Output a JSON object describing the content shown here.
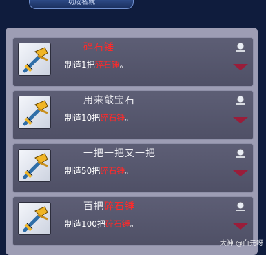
{
  "header": {
    "tab_title": "功成名就"
  },
  "cards": [
    {
      "title_plain": "",
      "title_highlight": "碎石锤",
      "desc_prefix": "制造1把",
      "desc_highlight": "碎石锤",
      "desc_suffix": "。"
    },
    {
      "title_plain": "用来敲宝石",
      "title_highlight": "",
      "desc_prefix": "制造10把",
      "desc_highlight": "碎石锤",
      "desc_suffix": "。"
    },
    {
      "title_plain": "一把一把又一把",
      "title_highlight": "",
      "desc_prefix": "制造50把",
      "desc_highlight": "碎石锤",
      "desc_suffix": "。"
    },
    {
      "title_plain": "百把",
      "title_highlight": "碎石锤",
      "desc_prefix": "制造100把",
      "desc_highlight": "碎石锤",
      "desc_suffix": "。"
    }
  ],
  "watermark": "大神 @白元呀",
  "icons": {
    "item": "hammer-icon",
    "pin": "pin-icon",
    "expand": "triangle-down-icon"
  }
}
